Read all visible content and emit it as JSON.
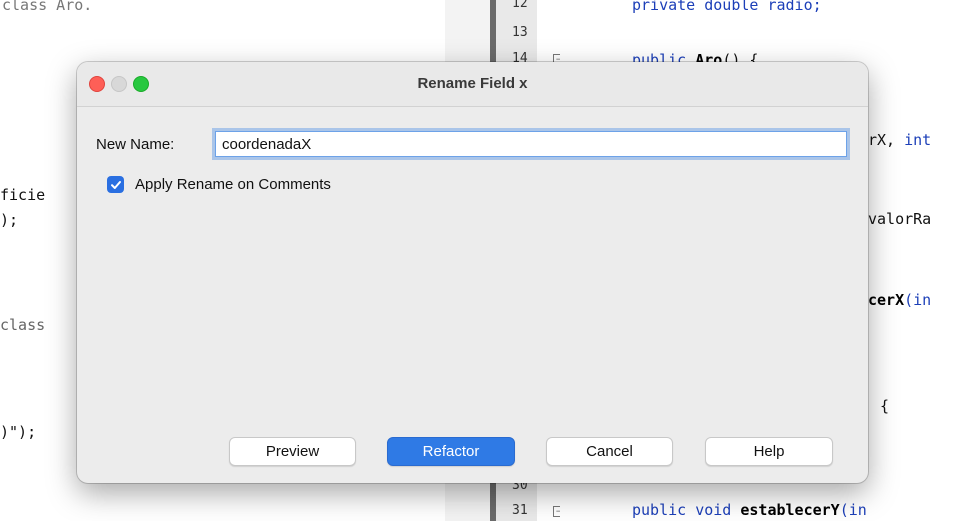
{
  "dialog": {
    "title": "Rename Field x",
    "new_name_label": "New Name:",
    "new_name_value": "coordenadaX",
    "apply_comments_label": "Apply Rename on Comments",
    "apply_comments_checked": true,
    "buttons": {
      "preview": "Preview",
      "refactor": "Refactor",
      "cancel": "Cancel",
      "help": "Help"
    }
  },
  "editor": {
    "left_fragments": {
      "class_line": "class Aro.",
      "ficie": "ficie",
      "paren_semicolon": ");",
      "class2": "class",
      "string_end": ")\");"
    },
    "line_numbers": [
      "12",
      "13",
      "14",
      "30",
      "31"
    ],
    "code_fragments": {
      "line12": "private double radio;",
      "line14_kw": "public",
      "line14_name": "Aro",
      "line14_rest": "() {",
      "x_int_a": "rX, ",
      "x_int_b": "int",
      "valor": "valorRa",
      "cer_bold": "cerX",
      "cer_rest": "(in",
      "brace": "{",
      "line31_kw": "public void",
      "line31_name": "establecerY",
      "line31_rest": "(in"
    }
  }
}
